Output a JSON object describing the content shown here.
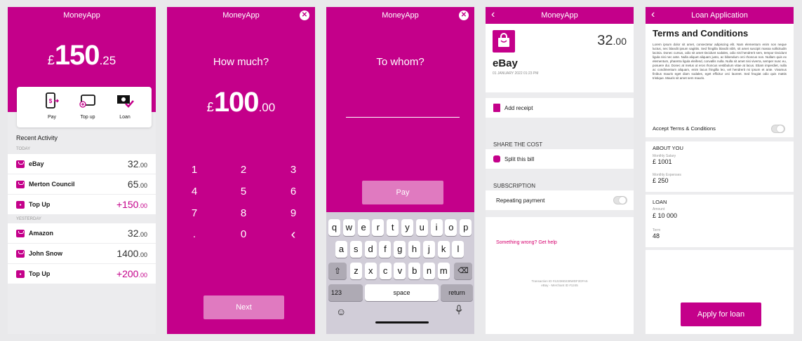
{
  "colors": {
    "brand": "#c4008a",
    "brand_light": "#e07ac0"
  },
  "home": {
    "title": "MoneyApp",
    "balance": {
      "currency": "£",
      "whole": "150",
      "dec": ".25"
    },
    "actions": [
      {
        "label": "Pay",
        "icon": "phone-pay-icon"
      },
      {
        "label": "Top up",
        "icon": "wallet-icon"
      },
      {
        "label": "Loan",
        "icon": "loan-icon"
      }
    ],
    "recent_title": "Recent Activity",
    "today_label": "TODAY",
    "yesterday_label": "YESTERDAY",
    "today": [
      {
        "name": "eBay",
        "whole": "32",
        "dec": ".00",
        "icon": "shopping-bag-icon"
      },
      {
        "name": "Merton Council",
        "whole": "65",
        "dec": ".00",
        "icon": "shopping-bag-icon"
      },
      {
        "name": "Top Up",
        "whole": "+150",
        "dec": ".00",
        "icon": "top-up-icon"
      }
    ],
    "yesterday": [
      {
        "name": "Amazon",
        "whole": "32",
        "dec": ".00",
        "icon": "shopping-bag-icon"
      },
      {
        "name": "John Snow",
        "whole": "1400",
        "dec": ".00",
        "icon": "shopping-bag-icon"
      },
      {
        "name": "Top Up",
        "whole": "+200",
        "dec": ".00",
        "icon": "top-up-icon"
      }
    ]
  },
  "amount": {
    "title": "MoneyApp",
    "question": "How much?",
    "value": {
      "currency": "£",
      "whole": "100",
      "dec": ".00"
    },
    "keys": [
      "1",
      "2",
      "3",
      "4",
      "5",
      "6",
      "7",
      "8",
      "9",
      ".",
      "0",
      "‹"
    ],
    "next": "Next"
  },
  "recipient": {
    "title": "MoneyApp",
    "question": "To whom?",
    "pay": "Pay",
    "row1": [
      "q",
      "w",
      "e",
      "r",
      "t",
      "y",
      "u",
      "i",
      "o",
      "p"
    ],
    "row2": [
      "a",
      "s",
      "d",
      "f",
      "g",
      "h",
      "j",
      "k",
      "l"
    ],
    "row3": [
      "z",
      "x",
      "c",
      "v",
      "b",
      "n",
      "m"
    ],
    "k123": "123",
    "space": "space",
    "return": "return"
  },
  "detail": {
    "title": "MoneyApp",
    "merchant": "eBay",
    "amount_whole": "32",
    "amount_dec": ".00",
    "date": "01 JANUARY 2022 01:23 PM",
    "add_receipt": "Add receipt",
    "share_title": "SHARE THE COST",
    "split": "Split this bill",
    "sub_title": "SUBSCRIPTION",
    "repeating": "Repeating payment",
    "help": "Something wrong? Get help",
    "txn_id": "Transaction ID #12236D238WDF2DFA5",
    "merchant_id": "eBay - Merchant ID #1245"
  },
  "loan": {
    "title": "Loan Application",
    "heading": "Terms and Conditions",
    "body": "Lorem ipsum dolor sit amet, consectetur adipiscing elit. Nam elementum enim non neque luctus, nec blandit ipsum sagittis. Sed fringilla blandit nibh, sit amet suscipit massa sollicitudin lacinia. Donec cursus, odio sit amet tincidunt sodales, odio nisl hendrerit sem, tempor tincidunt ligula nisi nec ante. Nulla aliquet aliquam justo, ac bibendum orci rhoncus non. Nullam quis ex elementum, pharetra ligula eleifend, convallis nulla. Nulla sit amet nisi viverra, semper nunc eu, posuere dui. Donec at metus ut eros rhoncus vestibulum vitae at lacus. Etiam imperdiet, nulla ac condimentum aliquam, enim lacus fringilla leo, vel hendrerit mi ipsum et ante. Vivamus finibus mauris eget diam sodales, eget efficitur orci laoreet. Sed feugiat odio quis mattis tristique. Mauris sit amet sem mauris.",
    "accept": "Accept Terms & Conditions",
    "about_title": "ABOUT YOU",
    "salary_label": "Monthly Salary",
    "salary": "£ 1001",
    "expenses_label": "Monthly Expenses",
    "expenses": "£ 250",
    "loan_title": "LOAN",
    "amount_label": "Amount",
    "amount": "£ 10 000",
    "term_label": "Term",
    "term": "48",
    "apply": "Apply for loan"
  }
}
